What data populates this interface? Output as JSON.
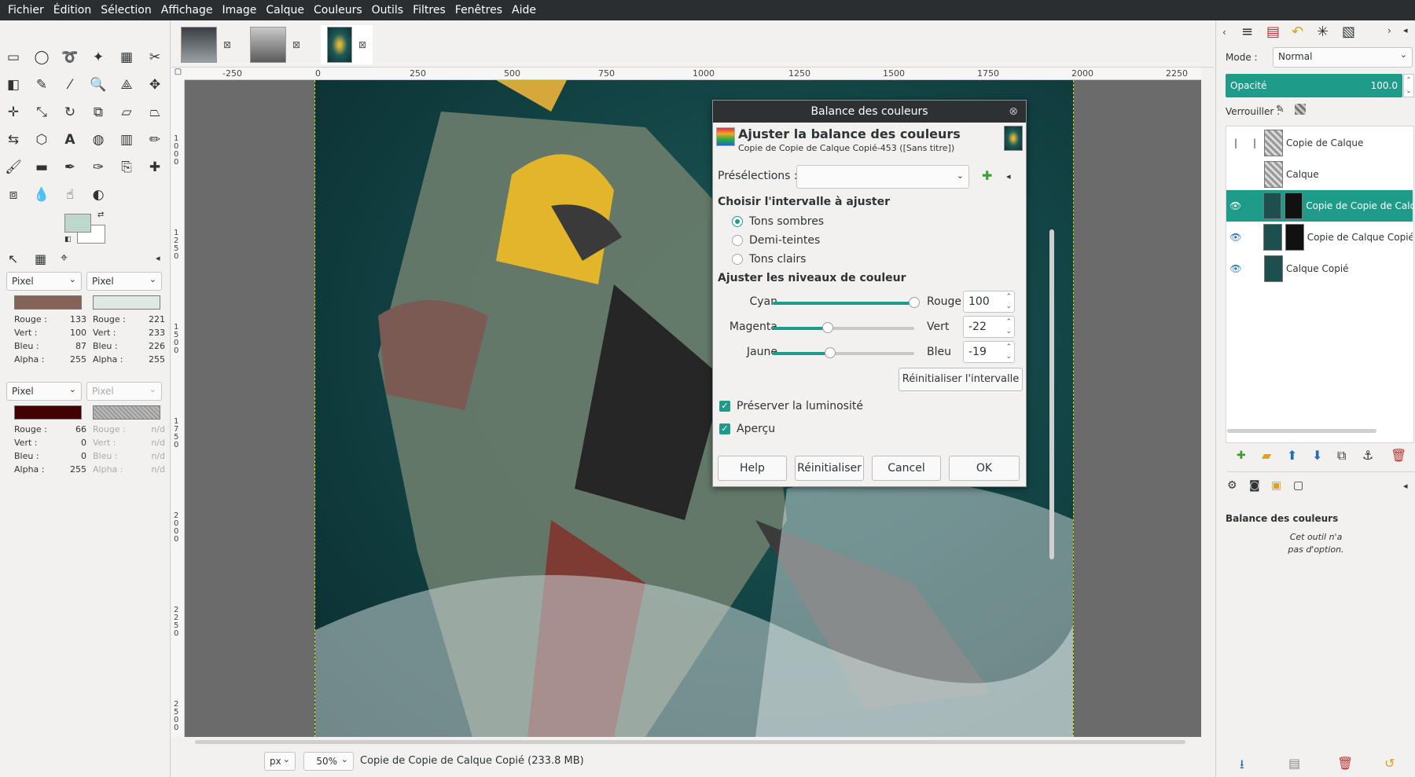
{
  "menubar": [
    "Fichier",
    "Édition",
    "Sélection",
    "Affichage",
    "Image",
    "Calque",
    "Couleurs",
    "Outils",
    "Filtres",
    "Fenêtres",
    "Aide"
  ],
  "toolbox": {
    "pointer_left": {
      "unit": "Pixel",
      "swatch_color": "#856457",
      "rows": [
        [
          "Rouge :",
          "133"
        ],
        [
          "Vert :",
          "100"
        ],
        [
          "Bleu :",
          "87"
        ],
        [
          "Alpha :",
          "255"
        ]
      ]
    },
    "pointer_right": {
      "unit": "Pixel",
      "swatch_color": "#dde9e2",
      "rows": [
        [
          "Rouge :",
          "221"
        ],
        [
          "Vert :",
          "233"
        ],
        [
          "Bleu :",
          "226"
        ],
        [
          "Alpha :",
          "255"
        ]
      ]
    },
    "sample_left": {
      "unit": "Pixel",
      "swatch_color": "#420000",
      "rows": [
        [
          "Rouge :",
          "66"
        ],
        [
          "Vert :",
          "0"
        ],
        [
          "Bleu :",
          "0"
        ],
        [
          "Alpha :",
          "255"
        ]
      ]
    },
    "sample_right": {
      "unit": "Pixel",
      "rows": [
        [
          "Rouge :",
          "n/d"
        ],
        [
          "Vert :",
          "n/d"
        ],
        [
          "Bleu :",
          "n/d"
        ],
        [
          "Alpha :",
          "n/d"
        ]
      ]
    },
    "fg_color": "#bfd8cd",
    "bg_color": "#ffffff"
  },
  "ruler": {
    "h_labels": [
      "-250",
      "0",
      "250",
      "500",
      "750",
      "1000",
      "1250",
      "1500",
      "1750",
      "2000",
      "2250"
    ],
    "v_labels": [
      "1000",
      "1250",
      "1500",
      "1750",
      "2000",
      "2250",
      "2500"
    ]
  },
  "statusbar": {
    "unit": "px",
    "zoom": "50%",
    "title": "Copie de Copie de Calque Copié (233.8 MB)"
  },
  "dock": {
    "mode_label": "Mode :",
    "mode_value": "Normal",
    "opacity_label": "Opacité",
    "opacity_value": "100.0",
    "lock_label": "Verrouiller :",
    "layers": [
      {
        "name": "Copie de Calque"
      },
      {
        "name": "Calque"
      },
      {
        "name": "Copie de Copie de Calq"
      },
      {
        "name": "Copie de Calque Copié"
      },
      {
        "name": "Calque Copié"
      }
    ],
    "tool_options_title": "Balance des couleurs",
    "tool_options_msg1": "Cet outil n'a",
    "tool_options_msg2": "pas d'option."
  },
  "dialog": {
    "title": "Balance des couleurs",
    "heading": "Ajuster la balance des couleurs",
    "subheading": "Copie de Copie de Calque Copié-453 ([Sans titre])",
    "presets_label": "Présélections :",
    "range_title": "Choisir l'intervalle à ajuster",
    "ranges": [
      "Tons sombres",
      "Demi-teintes",
      "Tons clairs"
    ],
    "levels_title": "Ajuster les niveaux de couleur",
    "sliders": [
      {
        "left": "Cyan",
        "right": "Rouge",
        "value": "100",
        "level": 100
      },
      {
        "left": "Magenta",
        "right": "Vert",
        "value": "-22",
        "level": -22
      },
      {
        "left": "Jaune",
        "right": "Bleu",
        "value": "-19",
        "level": -19
      }
    ],
    "reset_range": "Réinitialiser l'intervalle",
    "preserve_luminosity": "Préserver la luminosité",
    "preview": "Aperçu",
    "buttons": {
      "help": "Help",
      "reset": "Réinitialiser",
      "cancel": "Cancel",
      "ok": "OK"
    }
  }
}
